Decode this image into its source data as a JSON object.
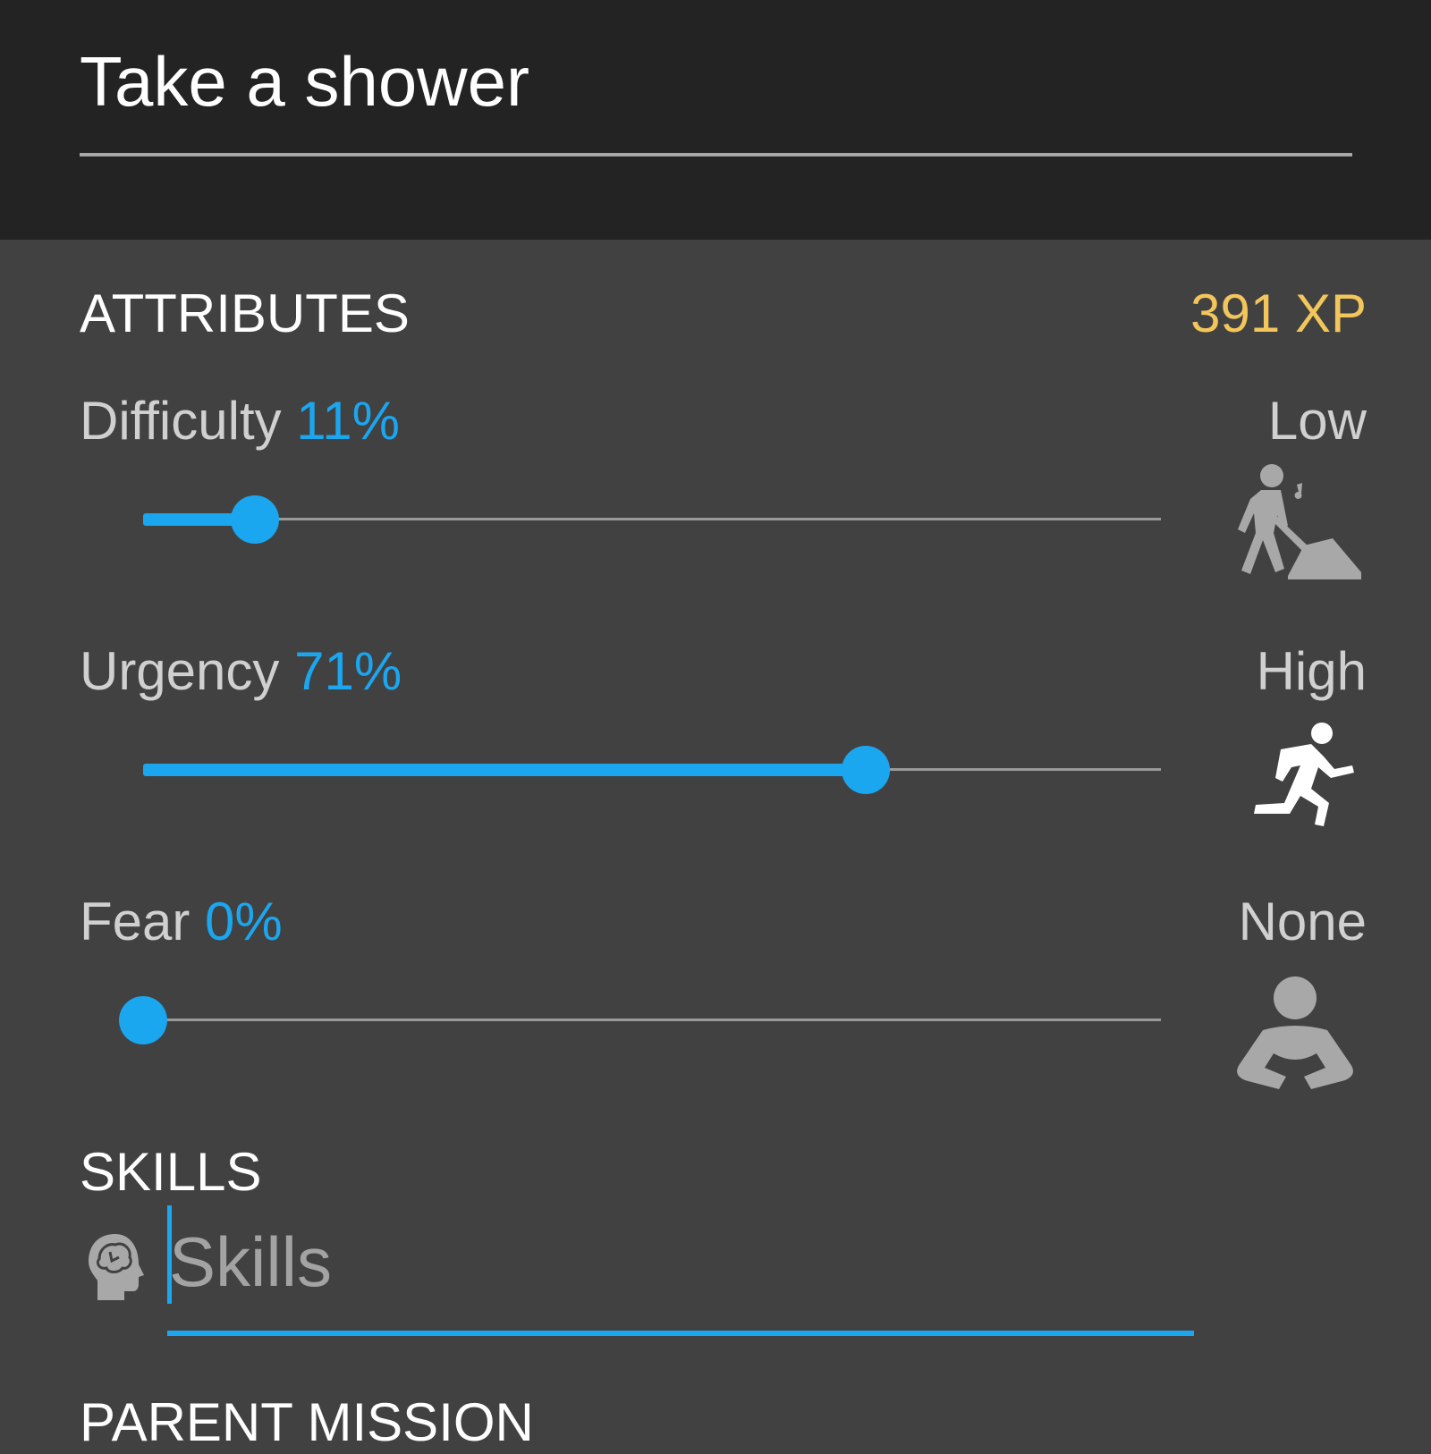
{
  "task": {
    "title": "Take a shower"
  },
  "attributes": {
    "header": "ATTRIBUTES",
    "xp": "391 XP",
    "difficulty": {
      "label": "Difficulty",
      "percent_text": "11%",
      "value": 11,
      "level": "Low",
      "icon": "worker-digging-icon"
    },
    "urgency": {
      "label": "Urgency",
      "percent_text": "71%",
      "value": 71,
      "level": "High",
      "icon": "running-person-icon"
    },
    "fear": {
      "label": "Fear",
      "percent_text": "0%",
      "value": 0,
      "level": "None",
      "icon": "calm-person-icon"
    }
  },
  "skills": {
    "header": "SKILLS",
    "placeholder": "Skills",
    "icon": "brain-head-icon"
  },
  "parent_mission": {
    "header": "PARENT MISSION"
  },
  "colors": {
    "accent": "#1ba6f0",
    "xp": "#f2c65b",
    "header_bg": "#232323",
    "body_bg": "#414141"
  }
}
